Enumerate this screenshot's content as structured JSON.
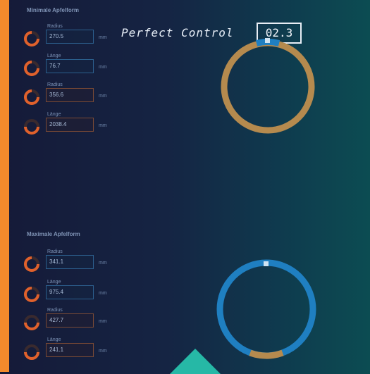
{
  "minimal": {
    "title": "Minimale Apfelform",
    "params": [
      {
        "label": "Radius",
        "value": "270.5",
        "unit": "mm"
      },
      {
        "label": "Länge",
        "value": "76.7",
        "unit": "mm"
      },
      {
        "label": "Radius",
        "value": "356.6",
        "unit": "mm"
      },
      {
        "label": "Länge",
        "value": "2038.4",
        "unit": "mm"
      }
    ]
  },
  "maximal": {
    "title": "Maximale Apfelform",
    "params": [
      {
        "label": "Radius",
        "value": "341.1",
        "unit": "mm"
      },
      {
        "label": "Länge",
        "value": "975.4",
        "unit": "mm"
      },
      {
        "label": "Radius",
        "value": "427.7",
        "unit": "mm"
      },
      {
        "label": "Länge",
        "value": "241.1",
        "unit": "mm"
      }
    ]
  },
  "perfect_control": {
    "title": "Perfect Control",
    "value": "02.3"
  },
  "colors": {
    "accent": "#f28a2c",
    "blue": "#1f7fc1",
    "gold": "#b58a4e",
    "teal": "#26b8a6"
  }
}
